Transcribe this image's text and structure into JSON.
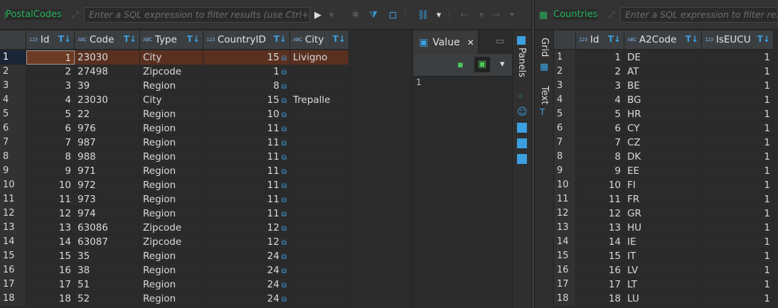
{
  "left": {
    "table_name": "PostalCodes",
    "filter_placeholder": "Enter a SQL expression to filter results (use Ctrl+Space)",
    "columns": [
      {
        "type_tag": "123",
        "label": "Id"
      },
      {
        "type_tag": "ABC",
        "label": "Code"
      },
      {
        "type_tag": "ABC",
        "label": "Type"
      },
      {
        "type_tag": "123",
        "label": "CountryID"
      },
      {
        "type_tag": "ABC",
        "label": "City"
      }
    ],
    "rows": [
      {
        "n": "1",
        "id": "1",
        "code": "23030",
        "type": "City",
        "country": "15",
        "city": "Livigno"
      },
      {
        "n": "2",
        "id": "2",
        "code": "27498",
        "type": "Zipcode",
        "country": "1",
        "city": ""
      },
      {
        "n": "3",
        "id": "3",
        "code": "39",
        "type": "Region",
        "country": "8",
        "city": ""
      },
      {
        "n": "4",
        "id": "4",
        "code": "23030",
        "type": "City",
        "country": "15",
        "city": "Trepalle"
      },
      {
        "n": "5",
        "id": "5",
        "code": "22",
        "type": "Region",
        "country": "10",
        "city": ""
      },
      {
        "n": "6",
        "id": "6",
        "code": "976",
        "type": "Region",
        "country": "11",
        "city": ""
      },
      {
        "n": "7",
        "id": "7",
        "code": "987",
        "type": "Region",
        "country": "11",
        "city": ""
      },
      {
        "n": "8",
        "id": "8",
        "code": "988",
        "type": "Region",
        "country": "11",
        "city": ""
      },
      {
        "n": "9",
        "id": "9",
        "code": "971",
        "type": "Region",
        "country": "11",
        "city": ""
      },
      {
        "n": "10",
        "id": "10",
        "code": "972",
        "type": "Region",
        "country": "11",
        "city": ""
      },
      {
        "n": "11",
        "id": "11",
        "code": "973",
        "type": "Region",
        "country": "11",
        "city": ""
      },
      {
        "n": "12",
        "id": "12",
        "code": "974",
        "type": "Region",
        "country": "11",
        "city": ""
      },
      {
        "n": "13",
        "id": "13",
        "code": "63086",
        "type": "Zipcode",
        "country": "12",
        "city": ""
      },
      {
        "n": "14",
        "id": "14",
        "code": "63087",
        "type": "Zipcode",
        "country": "12",
        "city": ""
      },
      {
        "n": "15",
        "id": "15",
        "code": "35",
        "type": "Region",
        "country": "24",
        "city": ""
      },
      {
        "n": "16",
        "id": "16",
        "code": "38",
        "type": "Region",
        "country": "24",
        "city": ""
      },
      {
        "n": "17",
        "id": "17",
        "code": "51",
        "type": "Region",
        "country": "24",
        "city": ""
      },
      {
        "n": "18",
        "id": "18",
        "code": "52",
        "type": "Region",
        "country": "24",
        "city": ""
      }
    ]
  },
  "value_panel": {
    "tab_label": "Value",
    "content": "1"
  },
  "side_strip": {
    "panels_label": "Panels"
  },
  "right": {
    "table_name": "Countries",
    "filter_placeholder": "Enter a SQL expression to filter results",
    "side_grid_label": "Grid",
    "side_text_label": "Text",
    "columns": [
      {
        "type_tag": "123",
        "label": "Id"
      },
      {
        "type_tag": "ABC",
        "label": "A2Code"
      },
      {
        "type_tag": "123",
        "label": "IsEUCU"
      }
    ],
    "rows": [
      {
        "n": "1",
        "id": "1",
        "a2": "DE",
        "eu": "1"
      },
      {
        "n": "2",
        "id": "2",
        "a2": "AT",
        "eu": "1"
      },
      {
        "n": "3",
        "id": "3",
        "a2": "BE",
        "eu": "1"
      },
      {
        "n": "4",
        "id": "4",
        "a2": "BG",
        "eu": "1"
      },
      {
        "n": "5",
        "id": "5",
        "a2": "HR",
        "eu": "1"
      },
      {
        "n": "6",
        "id": "6",
        "a2": "CY",
        "eu": "1"
      },
      {
        "n": "7",
        "id": "7",
        "a2": "CZ",
        "eu": "1"
      },
      {
        "n": "8",
        "id": "8",
        "a2": "DK",
        "eu": "1"
      },
      {
        "n": "9",
        "id": "9",
        "a2": "EE",
        "eu": "1"
      },
      {
        "n": "10",
        "id": "10",
        "a2": "FI",
        "eu": "1"
      },
      {
        "n": "11",
        "id": "11",
        "a2": "FR",
        "eu": "1"
      },
      {
        "n": "12",
        "id": "12",
        "a2": "GR",
        "eu": "1"
      },
      {
        "n": "13",
        "id": "13",
        "a2": "HU",
        "eu": "1"
      },
      {
        "n": "14",
        "id": "14",
        "a2": "IE",
        "eu": "1"
      },
      {
        "n": "15",
        "id": "15",
        "a2": "IT",
        "eu": "1"
      },
      {
        "n": "16",
        "id": "16",
        "a2": "LV",
        "eu": "1"
      },
      {
        "n": "17",
        "id": "17",
        "a2": "LT",
        "eu": "1"
      },
      {
        "n": "18",
        "id": "18",
        "a2": "LU",
        "eu": "1"
      }
    ]
  },
  "colors": {
    "accent": "#3aa0e0",
    "table_name": "#27b35b",
    "selected_row": "#5a3020"
  }
}
